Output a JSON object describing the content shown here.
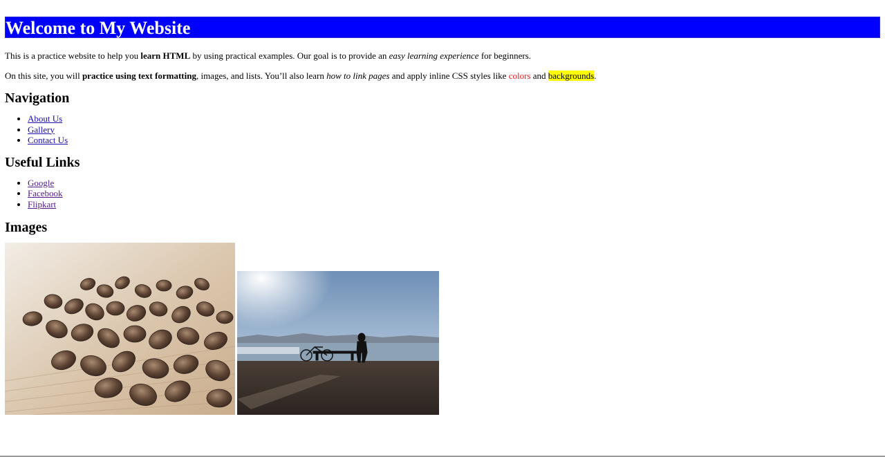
{
  "header": {
    "title": "Welcome to My Website"
  },
  "intro": {
    "p1": {
      "t1": "This is a practice website to help you ",
      "b1": "learn HTML",
      "t2": " by using practical examples. Our goal is to provide an ",
      "i1": "easy learning experience",
      "t3": " for beginners."
    },
    "p2": {
      "t1": "On this site, you will ",
      "b1": "practice using text formatting",
      "t2": ", images, and lists. You’ll also learn ",
      "i1": "how to link pages",
      "t3": " and apply inline CSS styles like ",
      "red": "colors",
      "t4": " and ",
      "hl": "backgrounds",
      "t5": "."
    }
  },
  "navigation": {
    "heading": "Navigation",
    "items": [
      {
        "label": "About Us"
      },
      {
        "label": "Gallery"
      },
      {
        "label": "Contact Us"
      }
    ]
  },
  "useful_links": {
    "heading": "Useful Links",
    "items": [
      {
        "label": "Google"
      },
      {
        "label": "Facebook"
      },
      {
        "label": "Flipkart"
      }
    ]
  },
  "images": {
    "heading": "Images"
  },
  "colors": {
    "banner": "#0000ff",
    "link": "#1a0dab",
    "visited": "#551a8b",
    "red_text": "#e02020",
    "highlight": "#ffff00"
  }
}
